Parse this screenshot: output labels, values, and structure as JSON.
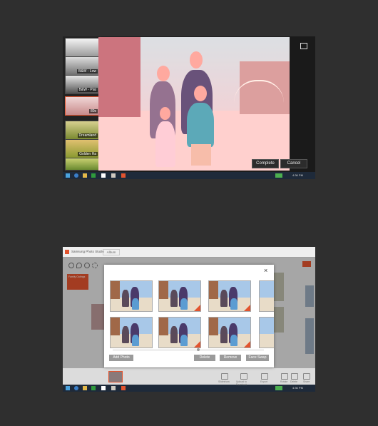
{
  "screen1": {
    "filters": [
      {
        "label": "B&W - Low"
      },
      {
        "label": "B&W - Plat"
      },
      {
        "label": "80s"
      },
      {
        "label": "Dreamland"
      },
      {
        "label": "Golden Ha"
      }
    ],
    "complete_label": "Complete",
    "cancel_label": "Cancel",
    "clock": "4:36 PM"
  },
  "screen2": {
    "app_title": "Samsung Photo Studio",
    "tab_label": "Album",
    "left_item": "Family Outings",
    "add_photo_label": "Add Photo",
    "delete_label": "Delete",
    "remove_label": "Remove",
    "face_swap_label": "Face Swap",
    "close_glyph": "×",
    "bottom_labels": [
      "Slideshow",
      "Upload to Facebook",
      "Export",
      "Rotate",
      "Delete",
      "Share"
    ],
    "clock": "4:36 PM"
  },
  "colors": {
    "accent": "#e2542f",
    "background": "#2f2f2f"
  }
}
